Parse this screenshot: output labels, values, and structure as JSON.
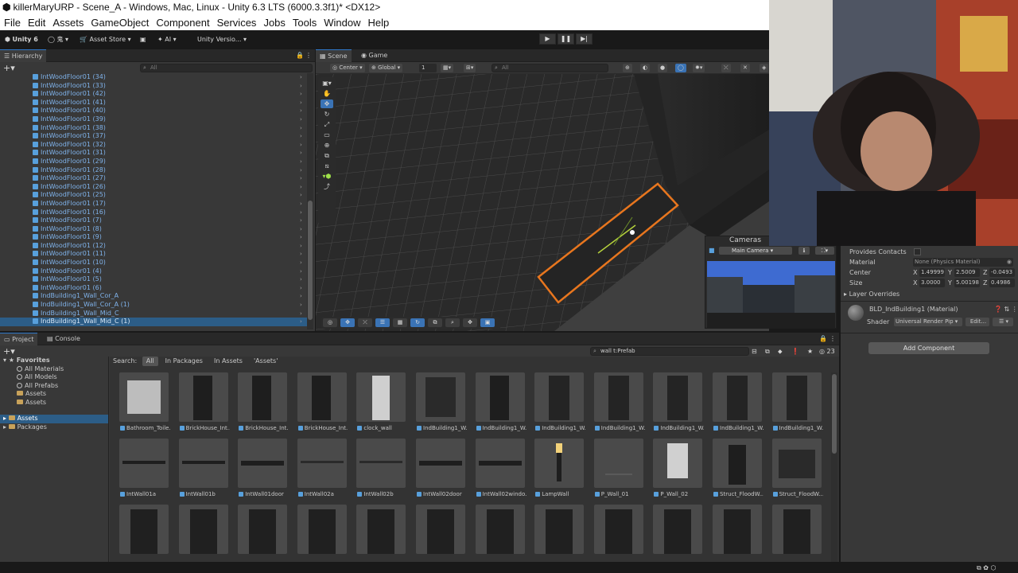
{
  "window": {
    "title": "killerMaryURP - Scene_A - Windows, Mac, Linux - Unity 6.3 LTS (6000.3.3f1)* <DX12>"
  },
  "menu": [
    "File",
    "Edit",
    "Assets",
    "GameObject",
    "Component",
    "Services",
    "Jobs",
    "Tools",
    "Window",
    "Help"
  ],
  "toolbar": {
    "unity_label": "Unity 6",
    "account_glyph": "鬼",
    "asset_store": "Asset Store",
    "ai_label": "AI",
    "version_control": "Unity Versio..."
  },
  "hierarchy": {
    "tab": "Hierarchy",
    "search_placeholder": "All",
    "items": [
      "IntWoodFloor01 (34)",
      "IntWoodFloor01 (33)",
      "IntWoodFloor01 (42)",
      "IntWoodFloor01 (41)",
      "IntWoodFloor01 (40)",
      "IntWoodFloor01 (39)",
      "IntWoodFloor01 (38)",
      "IntWoodFloor01 (37)",
      "IntWoodFloor01 (32)",
      "IntWoodFloor01 (31)",
      "IntWoodFloor01 (29)",
      "IntWoodFloor01 (28)",
      "IntWoodFloor01 (27)",
      "IntWoodFloor01 (26)",
      "IntWoodFloor01 (25)",
      "IntWoodFloor01 (17)",
      "IntWoodFloor01 (16)",
      "IntWoodFloor01 (7)",
      "IntWoodFloor01 (8)",
      "IntWoodFloor01 (9)",
      "IntWoodFloor01 (12)",
      "IntWoodFloor01 (11)",
      "IntWoodFloor01 (10)",
      "IntWoodFloor01 (4)",
      "IntWoodFloor01 (5)",
      "IntWoodFloor01 (6)",
      "IndBuilding1_Wall_Cor_A",
      "IndBuilding1_Wall_Cor_A (1)",
      "IndBuilding1_Wall_Mid_C",
      "IndBuilding1_Wall_Mid_C (1)"
    ]
  },
  "scene": {
    "tabs": [
      "Scene",
      "Game"
    ],
    "pivot": "Center",
    "space": "Global",
    "grid_value": "1",
    "search_placeholder": "All",
    "cameras_title": "Cameras",
    "camera_selected": "Main Camera"
  },
  "project": {
    "tabs": [
      "Project",
      "Console"
    ],
    "search_value": "wall t:Prefab",
    "result_count": "23",
    "search_label": "Search:",
    "scopes": [
      "All",
      "In Packages",
      "In Assets",
      "'Assets'"
    ],
    "favorites_label": "Favorites",
    "favorites": [
      "All Materials",
      "All Models",
      "All Prefabs",
      "Assets",
      "Assets"
    ],
    "roots": [
      "Assets",
      "Packages"
    ],
    "assets": [
      "Bathroom_Toile...",
      "BrickHouse_Int...",
      "BrickHouse_Int...",
      "BrickHouse_Int...",
      "clock_wall",
      "IndBuilding1_W...",
      "IndBuilding1_W...",
      "IndBuilding1_W...",
      "IndBuilding1_W...",
      "IndBuilding1_W...",
      "IndBuilding1_W...",
      "IndBuilding1_W...",
      "IntWall01a",
      "IntWall01b",
      "IntWall01door",
      "IntWall02a",
      "IntWall02b",
      "IntWall02door",
      "IntWall02windo...",
      "LampWall",
      "P_Wall_01",
      "P_Wall_02",
      "Struct_FloodW...",
      "Struct_FloodW..."
    ]
  },
  "inspector": {
    "provides_contacts": "Provides Contacts",
    "material_label": "Material",
    "material_value": "None (Physics Material)",
    "center_label": "Center",
    "center": {
      "x": "1.49999",
      "y": "2.5009",
      "z": "-0.0493"
    },
    "size_label": "Size",
    "size": {
      "x": "3.0000",
      "y": "5.00198",
      "z": "0.4986"
    },
    "layer_overrides": "Layer Overrides",
    "material_name": "BLD_IndBuilding1 (Material)",
    "shader_label": "Shader",
    "shader_value": "Universal Render Pip",
    "edit_button": "Edit...",
    "add_component": "Add Component"
  }
}
